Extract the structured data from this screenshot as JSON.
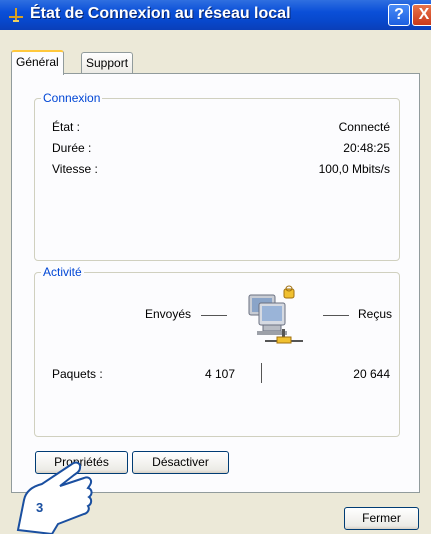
{
  "window": {
    "title": "État de Connexion au réseau local"
  },
  "titlebar": {
    "help_glyph": "?",
    "close_glyph": "X"
  },
  "tabs": [
    {
      "label": "Général"
    },
    {
      "label": "Support"
    }
  ],
  "connexion": {
    "title": "Connexion",
    "rows": [
      {
        "label": "État :",
        "value": "Connecté"
      },
      {
        "label": "Durée :",
        "value": "20:48:25"
      },
      {
        "label": "Vitesse :",
        "value": "100,0 Mbits/s"
      }
    ]
  },
  "activite": {
    "title": "Activité",
    "sent_label": "Envoyés",
    "received_label": "Reçus",
    "packets_label": "Paquets :",
    "packets_sent": "4 107",
    "packets_received": "20 644"
  },
  "buttons": {
    "properties": "Propriétés",
    "disable": "Désactiver",
    "close": "Fermer"
  },
  "callout": {
    "step": "3"
  },
  "colors": {
    "titlebar": "#0a4fd8",
    "group_title": "#0046d5",
    "tab_highlight": "#ffc83c"
  }
}
